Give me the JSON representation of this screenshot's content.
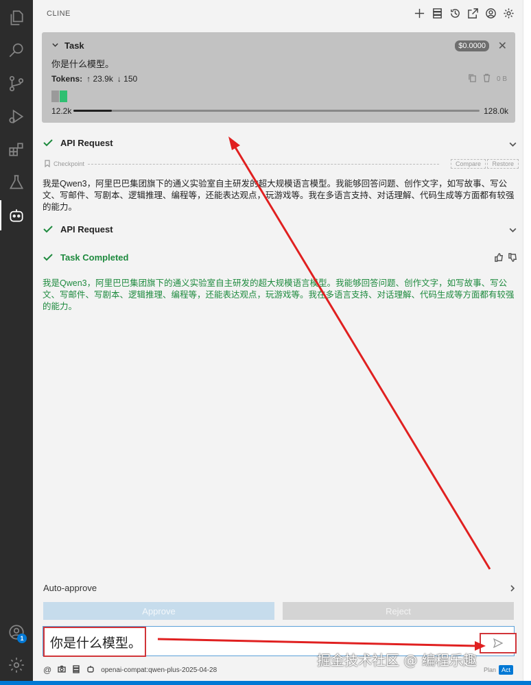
{
  "header": {
    "title": "CLINE"
  },
  "task": {
    "label": "Task",
    "cost": "$0.0000",
    "text": "你是什么模型。",
    "tokens_label": "Tokens:",
    "tokens_up": "↑ 23.9k",
    "tokens_down": "↓ 150",
    "size": "0 B",
    "context_used": "12.2k",
    "context_max": "128.0k",
    "context_fraction": 0.095
  },
  "rows": {
    "api_request_1": "API Request",
    "api_request_2": "API Request",
    "task_completed": "Task Completed"
  },
  "checkpoint": {
    "label": "Checkpoint",
    "compare": "Compare",
    "restore": "Restore"
  },
  "messages": {
    "response": "我是Qwen3，阿里巴巴集团旗下的通义实验室自主研发的超大规模语言模型。我能够回答问题、创作文字，如写故事、写公文、写邮件、写剧本、逻辑推理、编程等，还能表达观点，玩游戏等。我在多语言支持、对话理解、代码生成等方面都有较强的能力。",
    "completed": "我是Qwen3，阿里巴巴集团旗下的通义实验室自主研发的超大规模语言模型。我能够回答问题、创作文字，如写故事、写公文、写邮件、写剧本、逻辑推理、编程等，还能表达观点，玩游戏等。我在多语言支持、对话理解、代码生成等方面都有较强的能力。"
  },
  "auto_approve": {
    "label": "Auto-approve"
  },
  "buttons": {
    "approve": "Approve",
    "reject": "Reject"
  },
  "input": {
    "value": "你是什么模型。"
  },
  "footer": {
    "model": "openai-compat:qwen-plus-2025-04-28",
    "plan": "Plan",
    "act": "Act"
  },
  "activity": {
    "accounts_badge": "1"
  },
  "watermark": "掘金技术社区 @ 编程乐趣",
  "colors": {
    "accent": "#0078d4",
    "success": "#1e8a3e",
    "annotation": "#d13438"
  }
}
